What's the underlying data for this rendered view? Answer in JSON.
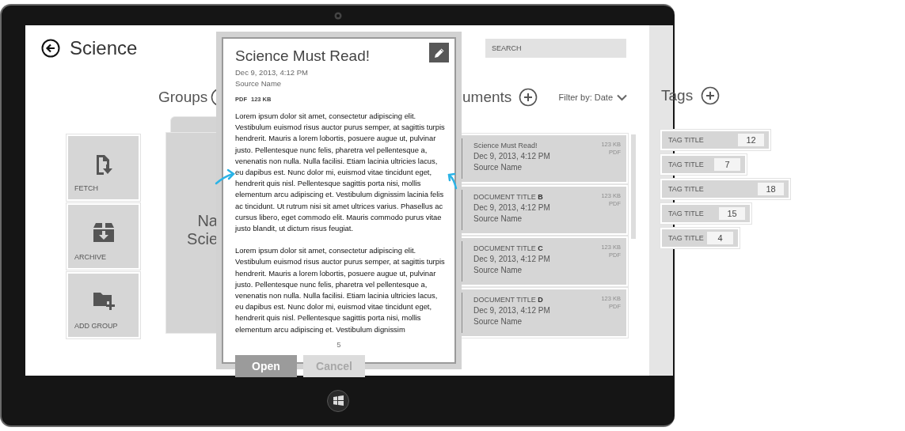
{
  "header": {
    "title": "Science",
    "search": {
      "placeholder": "SEARCH"
    }
  },
  "groups": {
    "heading": "Groups",
    "actions": [
      {
        "label": "FETCH",
        "kind": "fetch"
      },
      {
        "label": "ARCHIVE",
        "kind": "archive"
      },
      {
        "label": "ADD GROUP",
        "kind": "add"
      }
    ],
    "group_tile": {
      "lines": [
        "Na",
        "Scie"
      ]
    }
  },
  "documents": {
    "heading": "uments",
    "filter": "Filter by: Date",
    "items": [
      {
        "title": "Science Must Read!",
        "date": "Dec 9, 2013, 4:12 PM",
        "source": "Source Name",
        "size": "123 KB",
        "type": "PDF"
      },
      {
        "title": "DOCUMENT TITLE **B**",
        "date": "Dec 9, 2013, 4:12 PM",
        "source": "Source Name",
        "size": "123 KB",
        "type": "PDF"
      },
      {
        "title": "DOCUMENT TITLE **C**",
        "date": "Dec 9, 2013, 4:12 PM",
        "source": "Source Name",
        "size": "123 KB",
        "type": "PDF"
      },
      {
        "title": "DOCUMENT TITLE **D**",
        "date": "Dec 9, 2013, 4:12 PM",
        "source": "Source Name",
        "size": "123 KB",
        "type": "PDF"
      }
    ]
  },
  "tags": {
    "heading": "Tags",
    "items": [
      {
        "label": "TAG TITLE",
        "count": "12"
      },
      {
        "label": "TAG TITLE",
        "count": "7"
      },
      {
        "label": "TAG TITLE",
        "count": "18"
      },
      {
        "label": "TAG TITLE",
        "count": "15"
      },
      {
        "label": "TAG TITLE",
        "count": "4"
      }
    ]
  },
  "dialog": {
    "title": "Science Must Read!",
    "date": "Dec 9, 2013, 4:12 PM",
    "source": "Source Name",
    "file_type": "PDF",
    "file_size": "123 KB",
    "paragraphs": [
      "Lorem ipsum dolor sit amet, consectetur adipiscing elit. Vestibulum euismod risus auctor purus semper, at sagittis turpis hendrerit. Mauris a lorem lobortis, posuere augue ut, pulvinar justo. Pellentesque nunc felis, pharetra vel pellentesque a, venenatis non nulla. Nulla facilisi. Etiam lacinia ultricies lacus, eu dapibus est. Nunc dolor mi, euismod vitae tincidunt eget, hendrerit quis nisl. Pellentesque sagittis porta nisi, mollis elementum arcu adipiscing et. Vestibulum dignissim lacinia felis ac tincidunt. Ut rutrum nisi sit amet ultrices varius. Phasellus ac cursus libero, eget commodo elit. Mauris commodo purus vitae justo blandit, ut dictum risus feugiat.",
      "Lorem ipsum dolor sit amet, consectetur adipiscing elit. Vestibulum euismod risus auctor purus semper, at sagittis turpis hendrerit. Mauris a lorem lobortis, posuere augue ut, pulvinar justo. Pellentesque nunc felis, pharetra vel pellentesque a, venenatis non nulla. Nulla facilisi. Etiam lacinia ultricies lacus, eu dapibus est. Nunc dolor mi, euismod vitae tincidunt eget, hendrerit quis nisl. Pellentesque sagittis porta nisi, mollis elementum arcu adipiscing et. Vestibulum dignissim"
    ],
    "page": "5",
    "buttons": [
      {
        "label": "Open",
        "kind": "primary"
      },
      {
        "label": "Cancel",
        "kind": "secondary"
      }
    ]
  }
}
